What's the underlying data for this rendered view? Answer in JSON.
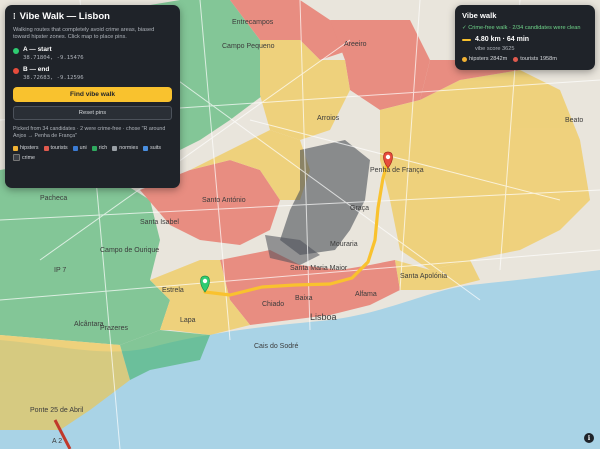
{
  "app": {
    "title": "Vibe Walk — Lisbon",
    "subtitle": "Walking routes that completely avoid crime areas, biased toward hipster zones. Click map to place pins.",
    "point_a": {
      "label": "A — start",
      "coords": "38.71804, -9.15476",
      "color": "#2ecc71"
    },
    "point_b": {
      "label": "B — end",
      "coords": "38.72683, -9.12596",
      "color": "#e74c3c"
    },
    "find_button": "Find vibe walk",
    "reset_button": "Reset pins",
    "note": "Picked from 34 candidates · 2 were crime-free · chose \"R around Anjos → Penha de França\"",
    "legend": [
      {
        "label": "hipsters",
        "color": "#f2b233"
      },
      {
        "label": "tourists",
        "color": "#e05a4e"
      },
      {
        "label": "uni",
        "color": "#3b7bd4"
      },
      {
        "label": "rich",
        "color": "#2faa5f"
      },
      {
        "label": "normies",
        "color": "#9aa0a6"
      },
      {
        "label": "suits",
        "color": "#4a8fe0"
      },
      {
        "label": "crime",
        "color": "#3b3f46"
      }
    ]
  },
  "result": {
    "title": "Vibe walk",
    "status": "✓ Crime-free walk · 2/34 candidates were clean",
    "distance": "4.80 km · 64 min",
    "score": "vibe score 3625",
    "mix": [
      {
        "label": "hipsters 2842m",
        "color": "#f2b233"
      },
      {
        "label": "tourists 1958m",
        "color": "#e05a4e"
      }
    ],
    "route_color": "#f9c22e"
  },
  "map": {
    "labels": [
      "Entrecampos",
      "Campo Pequeno",
      "Areeiro",
      "Arroios",
      "Penha de França",
      "Santo António",
      "Campo de Ourique",
      "Santa Isabel",
      "Estrela",
      "Lisboa",
      "Prazeres",
      "Alcântara",
      "Santa Apolónia",
      "Santa Maria Maior",
      "Cais do Sodré",
      "Ponte 25 de Abril",
      "Beato",
      "Lapa",
      "IP 7",
      "A 2",
      "Pacheca",
      "Mouraria",
      "Graça",
      "Alfama",
      "Chiado",
      "Baixa"
    ]
  },
  "info_icon": "info-icon"
}
